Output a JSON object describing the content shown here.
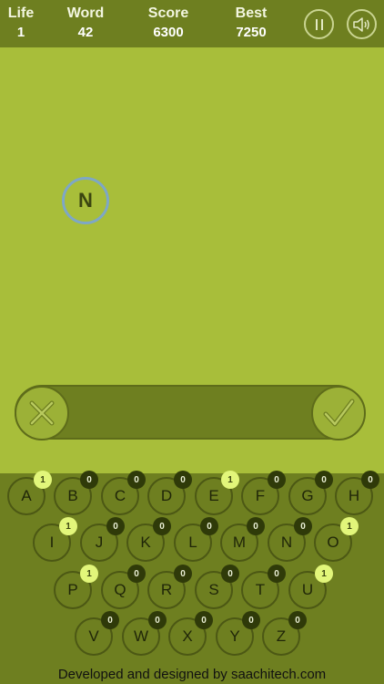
{
  "stats": {
    "life_label": "Life",
    "life_value": "1",
    "word_label": "Word",
    "word_value": "42",
    "score_label": "Score",
    "score_value": "6300",
    "best_label": "Best",
    "best_value": "7250"
  },
  "controls": {
    "pause_icon": "pause-icon",
    "sound_icon": "speaker-icon"
  },
  "tiles": [
    {
      "letter": "N"
    }
  ],
  "answer": {
    "current_text": "",
    "clear_icon": "x-icon",
    "submit_icon": "check-icon"
  },
  "keyboard": {
    "rows": [
      [
        {
          "letter": "A",
          "count": "1"
        },
        {
          "letter": "B",
          "count": "0"
        },
        {
          "letter": "C",
          "count": "0"
        },
        {
          "letter": "D",
          "count": "0"
        },
        {
          "letter": "E",
          "count": "1"
        },
        {
          "letter": "F",
          "count": "0"
        },
        {
          "letter": "G",
          "count": "0"
        },
        {
          "letter": "H",
          "count": "0"
        }
      ],
      [
        {
          "letter": "I",
          "count": "1"
        },
        {
          "letter": "J",
          "count": "0"
        },
        {
          "letter": "K",
          "count": "0"
        },
        {
          "letter": "L",
          "count": "0"
        },
        {
          "letter": "M",
          "count": "0"
        },
        {
          "letter": "N",
          "count": "0"
        },
        {
          "letter": "O",
          "count": "1"
        }
      ],
      [
        {
          "letter": "P",
          "count": "1"
        },
        {
          "letter": "Q",
          "count": "0"
        },
        {
          "letter": "R",
          "count": "0"
        },
        {
          "letter": "S",
          "count": "0"
        },
        {
          "letter": "T",
          "count": "0"
        },
        {
          "letter": "U",
          "count": "1"
        }
      ],
      [
        {
          "letter": "V",
          "count": "0"
        },
        {
          "letter": "W",
          "count": "0"
        },
        {
          "letter": "X",
          "count": "0"
        },
        {
          "letter": "Y",
          "count": "0"
        },
        {
          "letter": "Z",
          "count": "0"
        }
      ]
    ]
  },
  "footer": {
    "text": "Developed and designed by saachitech.com"
  },
  "colors": {
    "background": "#a8be3a",
    "bar": "#6e7f20",
    "badge_zero": "#2f3a09",
    "badge_one": "#e2f67a",
    "tile_ring": "#7ea7c6"
  }
}
